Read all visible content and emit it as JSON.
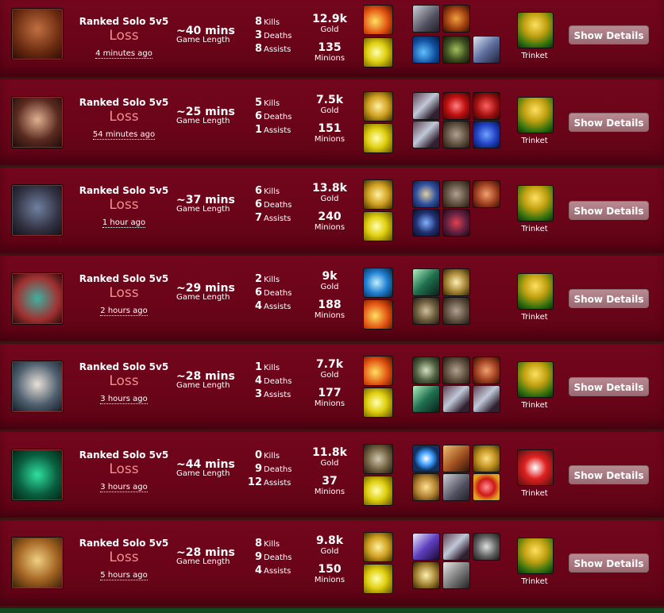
{
  "matches": [
    {
      "queue": "Ranked Solo 5v5",
      "result": "Loss",
      "ago": "4 minutes ago",
      "length": "~40 mins",
      "length_label": "Game Length",
      "kills": "8",
      "deaths": "3",
      "assists": "8",
      "kills_label": "Kills",
      "deaths_label": "Deaths",
      "assists_label": "Assists",
      "gold": "12.9k",
      "gold_label": "Gold",
      "minions": "135",
      "minions_label": "Minions",
      "trinket_label": "Trinket",
      "button": "Show Details",
      "champion_icon": "champion-portrait-pirate",
      "spells": [
        "spell-icon-ignite",
        "spell-icon-flash"
      ],
      "items": [
        [
          "item-icon-shield",
          "item-icon-armor"
        ],
        [
          "item-icon-boots-blue",
          "item-icon-boots-green",
          "item-icon-sword-winged"
        ]
      ],
      "trinket": "trinket-icon-yellow"
    },
    {
      "queue": "Ranked Solo 5v5",
      "result": "Loss",
      "ago": "54 minutes ago",
      "length": "~25 mins",
      "length_label": "Game Length",
      "kills": "5",
      "deaths": "6",
      "assists": "1",
      "kills_label": "Kills",
      "deaths_label": "Deaths",
      "assists_label": "Assists",
      "gold": "7.5k",
      "gold_label": "Gold",
      "minions": "151",
      "minions_label": "Minions",
      "trinket_label": "Trinket",
      "button": "Show Details",
      "champion_icon": "champion-portrait-sniper",
      "spells": [
        "spell-icon-heal",
        "spell-icon-flash"
      ],
      "items": [
        [
          "item-icon-longsword",
          "item-icon-potion",
          "item-icon-bow"
        ],
        [
          "item-icon-longsword",
          "item-icon-boots",
          "item-icon-cloak"
        ]
      ],
      "trinket": "trinket-icon-yellow"
    },
    {
      "queue": "Ranked Solo 5v5",
      "result": "Loss",
      "ago": "1 hour ago",
      "length": "~37 mins",
      "length_label": "Game Length",
      "kills": "6",
      "deaths": "6",
      "assists": "7",
      "kills_label": "Kills",
      "deaths_label": "Deaths",
      "assists_label": "Assists",
      "gold": "13.8k",
      "gold_label": "Gold",
      "minions": "240",
      "minions_label": "Minions",
      "trinket_label": "Trinket",
      "button": "Show Details",
      "champion_icon": "champion-portrait-cowboy",
      "spells": [
        "spell-icon-heal",
        "spell-icon-flash"
      ],
      "items": [
        [
          "item-icon-hourglass",
          "item-icon-boots",
          "item-icon-axe"
        ],
        [
          "item-icon-staff",
          "item-icon-hat",
          ""
        ]
      ],
      "trinket": "trinket-icon-yellow"
    },
    {
      "queue": "Ranked Solo 5v5",
      "result": "Loss",
      "ago": "2 hours ago",
      "length": "~29 mins",
      "length_label": "Game Length",
      "kills": "2",
      "deaths": "6",
      "assists": "4",
      "kills_label": "Kills",
      "deaths_label": "Deaths",
      "assists_label": "Assists",
      "gold": "9k",
      "gold_label": "Gold",
      "minions": "188",
      "minions_label": "Minions",
      "trinket_label": "Trinket",
      "button": "Show Details",
      "champion_icon": "champion-portrait-yordle",
      "spells": [
        "spell-icon-ghost",
        "spell-icon-ignite"
      ],
      "items": [
        [
          "item-icon-dagger-green",
          "item-icon-blade-gold",
          ""
        ],
        [
          "item-icon-shield-round",
          "item-icon-boots",
          ""
        ]
      ],
      "trinket": "trinket-icon-yellow"
    },
    {
      "queue": "Ranked Solo 5v5",
      "result": "Loss",
      "ago": "3 hours ago",
      "length": "~28 mins",
      "length_label": "Game Length",
      "kills": "1",
      "deaths": "4",
      "assists": "3",
      "kills_label": "Kills",
      "deaths_label": "Deaths",
      "assists_label": "Assists",
      "gold": "7.7k",
      "gold_label": "Gold",
      "minions": "177",
      "minions_label": "Minions",
      "trinket_label": "Trinket",
      "button": "Show Details",
      "champion_icon": "champion-portrait-warrior",
      "spells": [
        "spell-icon-ignite",
        "spell-icon-flash"
      ],
      "items": [
        [
          "item-icon-gauntlet",
          "item-icon-boots",
          "item-icon-axe"
        ],
        [
          "item-icon-dagger-green",
          "item-icon-longsword",
          "item-icon-longsword"
        ]
      ],
      "trinket": "trinket-icon-yellow"
    },
    {
      "queue": "Ranked Solo 5v5",
      "result": "Loss",
      "ago": "3 hours ago",
      "length": "~44 mins",
      "length_label": "Game Length",
      "kills": "0",
      "deaths": "9",
      "assists": "12",
      "kills_label": "Kills",
      "deaths_label": "Deaths",
      "assists_label": "Assists",
      "gold": "11.8k",
      "gold_label": "Gold",
      "minions": "37",
      "minions_label": "Minions",
      "trinket_label": "Trinket",
      "button": "Show Details",
      "champion_icon": "champion-portrait-shadow",
      "spells": [
        "spell-icon-exhaust",
        "spell-icon-flash"
      ],
      "items": [
        [
          "item-icon-eye",
          "item-icon-armor-gold",
          "item-icon-orb-gold"
        ],
        [
          "item-icon-boots-gold",
          "item-icon-shield",
          "item-icon-orb-red"
        ]
      ],
      "trinket": "trinket-icon-red"
    },
    {
      "queue": "Ranked Solo 5v5",
      "result": "Loss",
      "ago": "5 hours ago",
      "length": "~28 mins",
      "length_label": "Game Length",
      "kills": "8",
      "deaths": "9",
      "assists": "4",
      "kills_label": "Kills",
      "deaths_label": "Deaths",
      "assists_label": "Assists",
      "gold": "9.8k",
      "gold_label": "Gold",
      "minions": "150",
      "minions_label": "Minions",
      "trinket_label": "Trinket",
      "button": "Show Details",
      "champion_icon": "champion-portrait-blonde",
      "spells": [
        "spell-icon-heal",
        "spell-icon-flash"
      ],
      "items": [
        [
          "item-icon-blade-purple",
          "item-icon-longsword",
          "item-icon-axe-spiked"
        ],
        [
          "item-icon-blade-gold",
          "item-icon-greatsword",
          ""
        ]
      ],
      "trinket": "trinket-icon-yellow"
    }
  ],
  "colors": {
    "row_bg": "#6a0419",
    "loss_text": "#f08f8f",
    "button_bg": "#a87980",
    "footer": "#12491f"
  }
}
